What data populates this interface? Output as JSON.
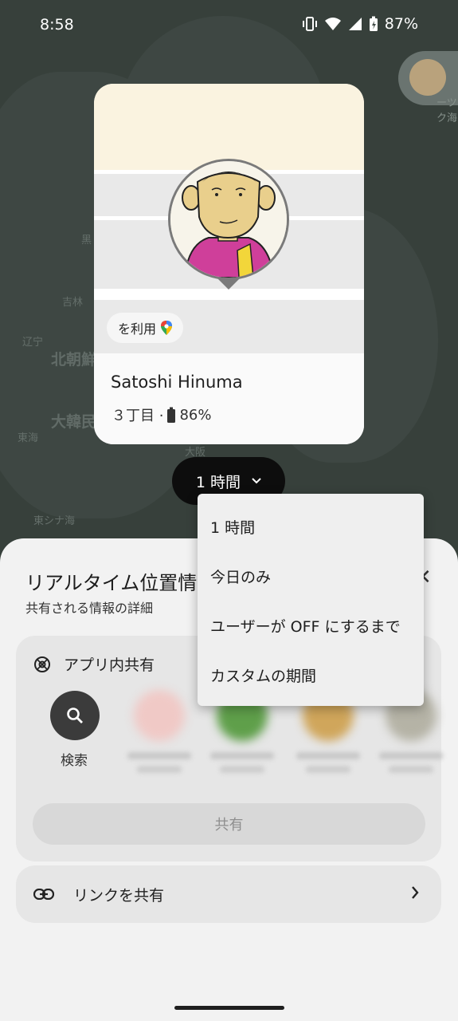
{
  "status_bar": {
    "time": "8:58",
    "battery": "87%"
  },
  "map": {
    "labels": [
      "北朝鮮",
      "大韓民",
      "東海",
      "東シナ海",
      "吉林",
      "辽宁",
      "黑",
      "大阪",
      "ーツク海"
    ]
  },
  "card": {
    "uses_label": "を利用",
    "name": "Satoshi Hinuma",
    "location": "３丁目 ·",
    "battery": "86%"
  },
  "duration": {
    "selected": "1 時間"
  },
  "menu": {
    "items": [
      "1 時間",
      "今日のみ",
      "ユーザーが OFF にするまで",
      "カスタムの期間"
    ]
  },
  "sheet": {
    "title": "リアルタイム位置情報の共有",
    "subtitle": "共有される情報の詳細",
    "in_app_share_label": "アプリ内共有",
    "search_label": "検索",
    "share_button": "共有",
    "share_link_label": "リンクを共有"
  },
  "colors": {
    "dark_pill": "#0d0d0d",
    "sheet_bg": "#f2f2f2",
    "map_bg": "#424b46"
  }
}
